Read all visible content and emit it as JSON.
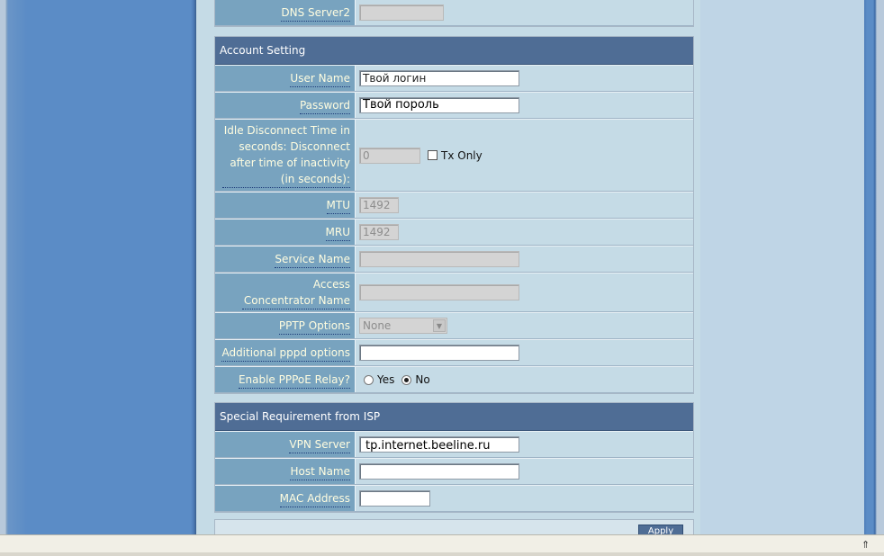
{
  "top_fragment": {
    "dns2_label": "DNS Server2",
    "dns2_value": ""
  },
  "account_setting": {
    "title": "Account Setting",
    "username_label": "User Name",
    "username_value": "Твой логин",
    "password_label": "Password",
    "password_value": "Твой пороль",
    "idle_label": "Idle Disconnect Time in seconds: Disconnect after time of inactivity (in seconds):",
    "idle_value": "0",
    "tx_only_label": "Tx Only",
    "mtu_label": "MTU",
    "mtu_value": "1492",
    "mru_label": "MRU",
    "mru_value": "1492",
    "service_name_label": "Service Name",
    "service_name_value": "",
    "access_concentrator_label": "Access Concentrator Name",
    "access_concentrator_value": "",
    "pptp_options_label": "PPTP Options",
    "pptp_options_selected": "None",
    "additional_pppd_label": "Additional pppd options",
    "additional_pppd_value": "",
    "pppoe_relay_label": "Enable PPPoE Relay?",
    "pppoe_relay_yes": "Yes",
    "pppoe_relay_no": "No",
    "pppoe_relay_selected": "No"
  },
  "special_requirement": {
    "title": "Special Requirement from ISP",
    "vpn_server_label": "VPN Server",
    "vpn_server_value": "tp.internet.beeline.ru",
    "host_name_label": "Host Name",
    "host_name_value": "",
    "mac_address_label": "MAC Address",
    "mac_address_value": ""
  },
  "apply": {
    "label": "Apply"
  },
  "icons": {
    "statusbar_arrow": "chevron-up-icon"
  }
}
